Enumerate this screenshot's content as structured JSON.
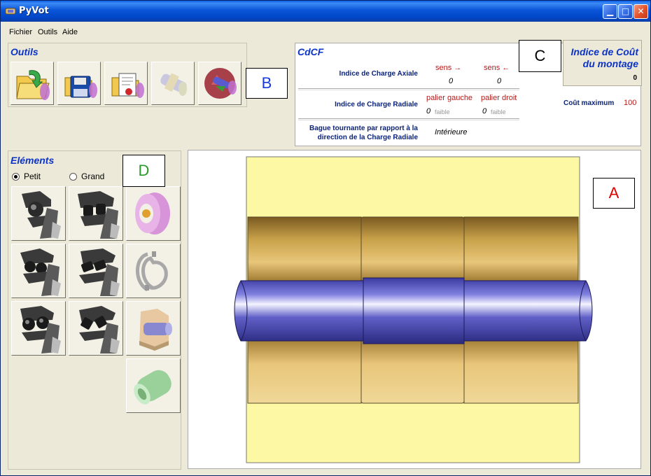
{
  "window": {
    "title": "PyVot"
  },
  "menu": {
    "items": [
      "Fichier",
      "Outils",
      "Aide"
    ]
  },
  "tools": {
    "title": "Outils",
    "buttons": [
      {
        "icon": "open-folder-icon"
      },
      {
        "icon": "save-disk-icon"
      },
      {
        "icon": "report-icon"
      },
      {
        "icon": "assembly-icon"
      },
      {
        "icon": "recycle-icon"
      }
    ]
  },
  "cdcf": {
    "title": "CdCF",
    "axial_label": "Indice de Charge Axiale",
    "sens_right": "sens →",
    "sens_left": "sens ←",
    "axial_right_value": "0",
    "axial_left_value": "0",
    "radial_label": "Indice de Charge Radiale",
    "palier_gauche": "palier gauche",
    "palier_droit": "palier droit",
    "radial_left_value": "0",
    "radial_left_level": "faible",
    "radial_right_value": "0",
    "radial_right_level": "faible",
    "ring_label_1": "Bague tournante par rapport à la",
    "ring_label_2": "direction de la Charge Radiale",
    "ring_value": "Intérieure",
    "cost_max_label": "Coût maximum",
    "cost_max_value": "100"
  },
  "cost": {
    "title_1": "Indice de Coût",
    "title_2": "du montage",
    "value": "0"
  },
  "elements": {
    "title": "Eléments",
    "size_small": "Petit",
    "size_large": "Grand",
    "selected_size": "Petit"
  },
  "callouts": {
    "a": "A",
    "b": "B",
    "c": "C",
    "d": "D"
  },
  "colors": {
    "title_blue": "#0b33c7",
    "label_navy": "#0b237a",
    "value_red": "#b81a1a",
    "housing_yellow": "#fdf8a3",
    "bearing_bronze": "#c9a24a",
    "shaft_blue": "#4a4ab0",
    "callout_red": "#e00000",
    "callout_green": "#2a9a2a"
  }
}
